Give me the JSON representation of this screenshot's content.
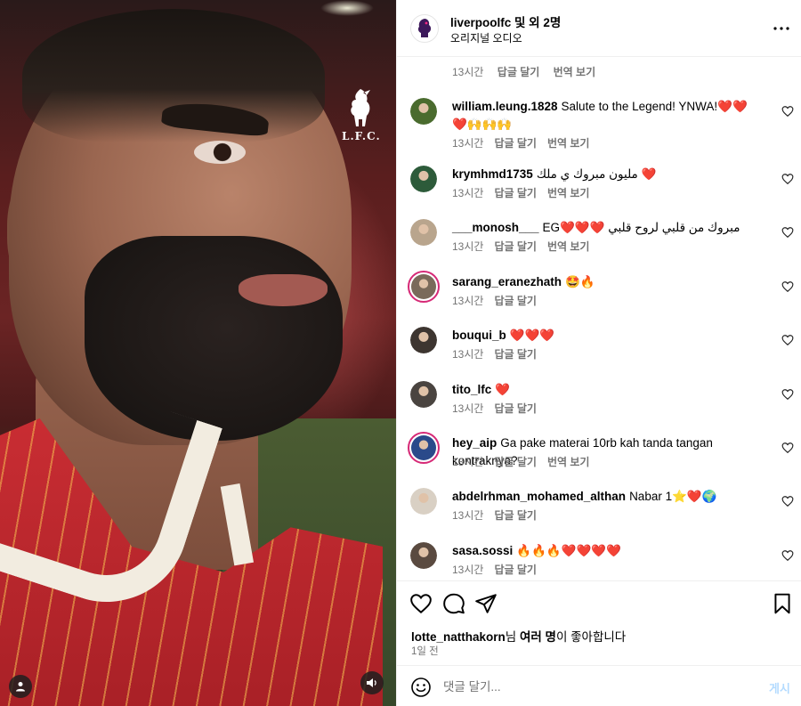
{
  "header": {
    "title": "liverpoolfc 및 외 2명",
    "subtitle": "오리지널 오디오",
    "more_icon": "more-horizontal-icon"
  },
  "media": {
    "logo_text": "L.F.C."
  },
  "first_meta": {
    "time": "13시간",
    "reply": "답글 달기",
    "translate": "번역 보기"
  },
  "comments": [
    {
      "user": "william.leung.1828",
      "text": "Salute to the Legend! YNWA!❤️❤️❤️🙌🙌🙌",
      "time": "13시간",
      "reply": "답글 달기",
      "translate": "번역 보기",
      "avatar_color": "#4a6b2e",
      "story": false
    },
    {
      "user": "krymhmd1735",
      "text": "مليون مبروك ي ملك ❤️",
      "time": "13시간",
      "reply": "답글 달기",
      "translate": "번역 보기",
      "avatar_color": "#2d5b3a",
      "story": false
    },
    {
      "user": "___monosh___",
      "text": "EG❤️❤️❤️ مبروك من قلبي لروح قلبي",
      "time": "13시간",
      "reply": "답글 달기",
      "translate": "번역 보기",
      "avatar_color": "#b9a58d",
      "story": false
    },
    {
      "user": "sarang_eranezhath",
      "text": "🤩🔥",
      "time": "13시간",
      "reply": "답글 달기",
      "translate": "",
      "avatar_color": "#7a6a5a",
      "story": true
    },
    {
      "user": "bouqui_b",
      "text": "❤️❤️❤️",
      "time": "13시간",
      "reply": "답글 달기",
      "translate": "",
      "avatar_color": "#3d3530",
      "story": false
    },
    {
      "user": "tito_lfc",
      "text": "❤️",
      "time": "13시간",
      "reply": "답글 달기",
      "translate": "",
      "avatar_color": "#4a4440",
      "story": false
    },
    {
      "user": "hey_aip",
      "text": "Ga pake materai 10rb kah tanda tangan kontraknya?",
      "time": "13시간",
      "reply": "답글 달기",
      "translate": "번역 보기",
      "avatar_color": "#2a4a8a",
      "story": true
    },
    {
      "user": "abdelrhman_mohamed_althan",
      "text": "Nabar 1⭐❤️🌍",
      "time": "13시간",
      "reply": "답글 달기",
      "translate": "",
      "avatar_color": "#d9d0c4",
      "story": false
    },
    {
      "user": "sasa.sossi",
      "text": "🔥🔥🔥❤️❤️❤️❤️",
      "time": "13시간",
      "reply": "답글 달기",
      "translate": "",
      "avatar_color": "#5a4a40",
      "story": false
    }
  ],
  "likes": {
    "user": "lotte_natthakorn",
    "suffix1": "님 ",
    "many": "여러 명",
    "suffix2": "이 좋아합니다",
    "ago": "1일 전"
  },
  "composer": {
    "placeholder": "댓글 달기...",
    "post_label": "게시"
  },
  "colors": {
    "accent": "#0095f6",
    "post_disabled": "#b3dbff",
    "heart_red": "#ed1c24",
    "lfc_red": "#c1272d"
  }
}
